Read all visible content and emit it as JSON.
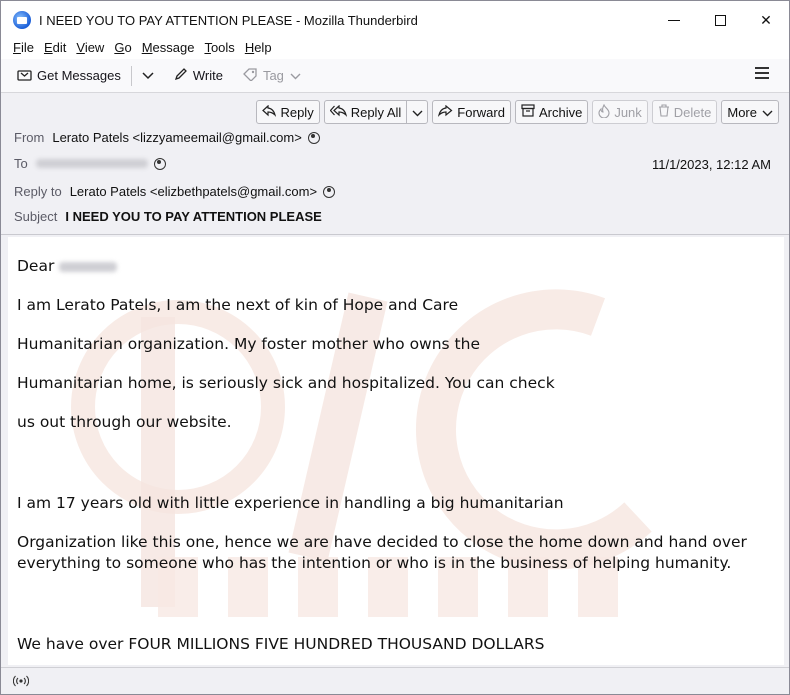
{
  "window": {
    "title": "I NEED YOU TO PAY ATTENTION PLEASE - Mozilla Thunderbird",
    "controls": {
      "minimize": "minimize",
      "maximize": "maximize",
      "close": "✕"
    }
  },
  "menu": [
    "File",
    "Edit",
    "View",
    "Go",
    "Message",
    "Tools",
    "Help"
  ],
  "menu_access": [
    "F",
    "E",
    "V",
    "G",
    "M",
    "T",
    "H"
  ],
  "toolbar": {
    "get_messages": "Get Messages",
    "write": "Write",
    "tag": "Tag"
  },
  "actions": {
    "reply": "Reply",
    "reply_all": "Reply All",
    "forward": "Forward",
    "archive": "Archive",
    "junk": "Junk",
    "delete": "Delete",
    "more": "More"
  },
  "header": {
    "from_label": "From",
    "from_value": "Lerato Patels <lizzyameemail@gmail.com>",
    "to_label": "To",
    "date": "11/1/2023, 12:12 AM",
    "reply_to_label": "Reply to",
    "reply_to_value": "Lerato Patels <elizbethpatels@gmail.com>",
    "subject_label": "Subject",
    "subject_value": "I NEED YOU TO PAY ATTENTION PLEASE"
  },
  "body": {
    "greeting": "Dear",
    "lines": [
      "I am Lerato Patels, I am the next of kin of Hope and Care",
      "Humanitarian organization. My foster mother who owns the",
      "Humanitarian home, is seriously sick and hospitalized. You can check",
      "us out through our website.",
      "I am 17 years old with little experience in handling a big humanitarian",
      "Organization like this one, hence we are have decided to close the home down and hand over everything to someone who has the intention or who is in the business of helping humanity.",
      "We have over FOUR MILLIONS FIVE HUNDRED THOUSAND DOLLARS"
    ]
  },
  "colors": {
    "accent": "#1a5ed8",
    "watermark": "#f4ded6"
  }
}
